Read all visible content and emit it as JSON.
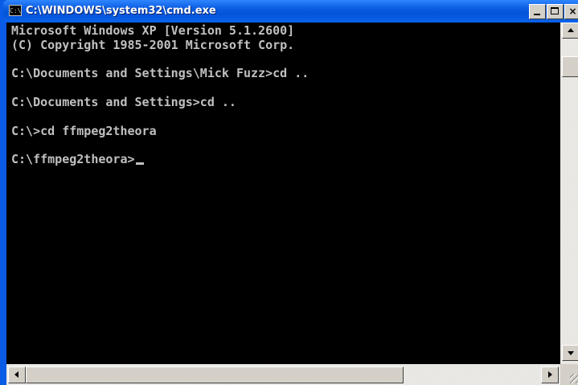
{
  "window": {
    "title": "C:\\WINDOWS\\system32\\cmd.exe",
    "icon": "cmd-icon",
    "icon_text": "C:\\",
    "buttons": {
      "minimize": "minimize-icon",
      "maximize": "maximize-icon",
      "close_label": "×"
    },
    "colors": {
      "titlebar": "#0a5ce6",
      "console_bg": "#000000",
      "console_fg": "#c0c0c0"
    }
  },
  "console": {
    "lines": [
      "Microsoft Windows XP [Version 5.1.2600]",
      "(C) Copyright 1985-2001 Microsoft Corp.",
      "",
      "C:\\Documents and Settings\\Mick Fuzz>cd ..",
      "",
      "C:\\Documents and Settings>cd ..",
      "",
      "C:\\>cd ffmpeg2theora",
      "",
      "C:\\ffmpeg2theora>"
    ]
  },
  "scrollbars": {
    "vertical": "vertical-scrollbar",
    "horizontal": "horizontal-scrollbar"
  }
}
